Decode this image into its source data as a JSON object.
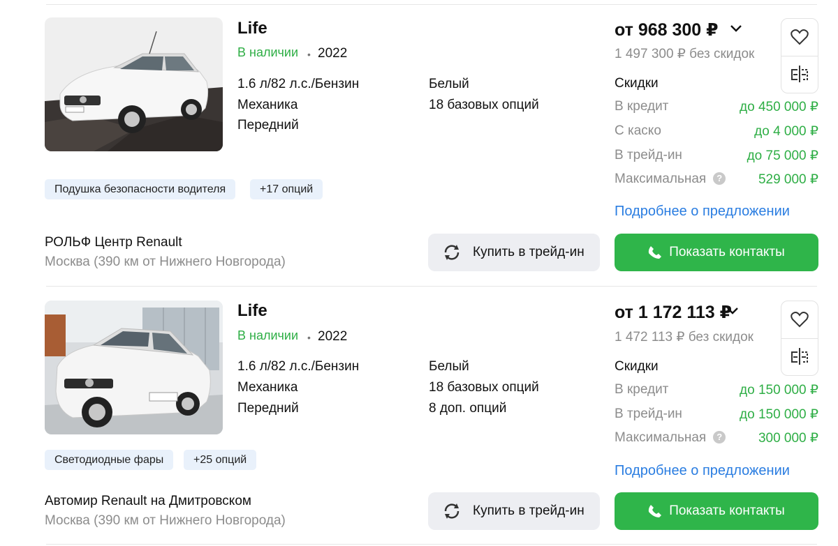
{
  "listings": [
    {
      "title": "Life",
      "status": "В наличии",
      "dot": "•",
      "year": "2022",
      "specs_left": [
        "1.6 л/82 л.с./Бензин",
        "Механика",
        "Передний"
      ],
      "specs_right": [
        "Белый",
        "18 базовых опций"
      ],
      "tags": [
        "Подушка безопасности водителя",
        "+17 опций"
      ],
      "dealer": "РОЛЬФ Центр Renault",
      "location": "Москва (390 км от Нижнего Новгорода)",
      "trade_in_label": "Купить в трейд-ин",
      "contacts_label": "Показать контакты",
      "price": "от 968 300 ₽",
      "old_price": "1 497 300 ₽ без скидок",
      "discounts_title": "Скидки",
      "discounts": [
        {
          "label": "В кредит",
          "value": "до 450 000 ₽"
        },
        {
          "label": "С каско",
          "value": "до 4 000 ₽"
        },
        {
          "label": "В трейд-ин",
          "value": "до 75 000 ₽"
        },
        {
          "label": "Максимальная",
          "value": "529 000 ₽",
          "help": "?"
        }
      ],
      "details_link": "Подробнее о предложении",
      "photo_icon": "white-sedan-showroom-photo"
    },
    {
      "title": "Life",
      "status": "В наличии",
      "dot": "•",
      "year": "2022",
      "specs_left": [
        "1.6 л/82 л.с./Бензин",
        "Механика",
        "Передний"
      ],
      "specs_right": [
        "Белый",
        "18 базовых опций",
        "8 доп. опций"
      ],
      "tags": [
        "Светодиодные фары",
        "+25 опций"
      ],
      "dealer": "Автомир Renault на Дмитровском",
      "location": "Москва (390 км от Нижнего Новгорода)",
      "trade_in_label": "Купить в трейд-ин",
      "contacts_label": "Показать контакты",
      "price": "от 1 172 113 ₽",
      "old_price": "1 472 113 ₽ без скидок",
      "discounts_title": "Скидки",
      "discounts": [
        {
          "label": "В кредит",
          "value": "до 150 000 ₽"
        },
        {
          "label": "В трейд-ин",
          "value": "до 150 000 ₽"
        },
        {
          "label": "Максимальная",
          "value": "300 000 ₽",
          "help": "?"
        }
      ],
      "details_link": "Подробнее о предложении",
      "photo_icon": "white-sedan-dealership-photo"
    }
  ],
  "colors": {
    "accent_green": "#2fb54a",
    "status_green": "#2eae45",
    "link_blue": "#2a7de1",
    "tag_bg": "#e9f1fb",
    "muted_text": "#8c8c8c"
  },
  "icons": [
    "heart-icon",
    "compare-icon",
    "chevron-down-icon",
    "refresh-icon",
    "phone-icon",
    "help-icon"
  ]
}
